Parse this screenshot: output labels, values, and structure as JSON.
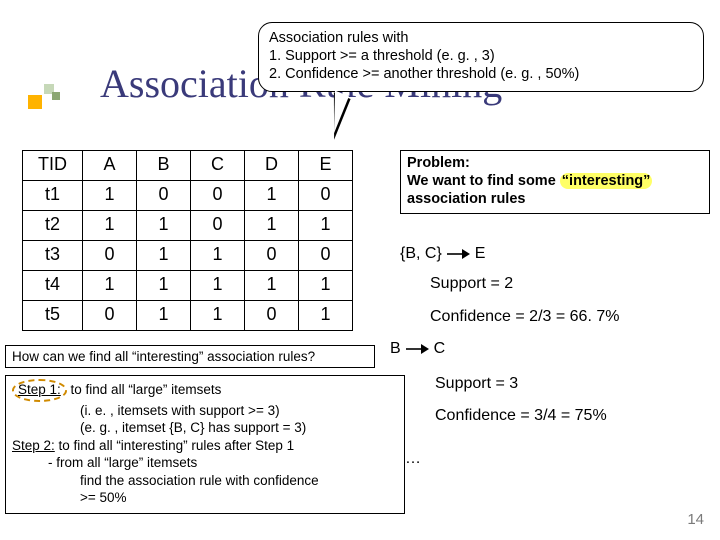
{
  "title": "Association Rule Mining",
  "callout": {
    "l1": "Association rules with",
    "l2": "1. Support >= a threshold (e. g. , 3)",
    "l3": "2. Confidence >= another threshold (e. g. , 50%)"
  },
  "table": {
    "headers": [
      "TID",
      "A",
      "B",
      "C",
      "D",
      "E"
    ],
    "rows": [
      [
        "t1",
        "1",
        "0",
        "0",
        "1",
        "0"
      ],
      [
        "t2",
        "1",
        "1",
        "0",
        "1",
        "1"
      ],
      [
        "t3",
        "0",
        "1",
        "1",
        "0",
        "0"
      ],
      [
        "t4",
        "1",
        "1",
        "1",
        "1",
        "1"
      ],
      [
        "t5",
        "0",
        "1",
        "1",
        "0",
        "1"
      ]
    ]
  },
  "problem": {
    "l1": "Problem:",
    "l2a": "We want to find some ",
    "l2b": "“interesting”",
    "l3": "association rules"
  },
  "ex1": {
    "lhs": "{B, C}",
    "rhs": "E",
    "support": "Support = 2",
    "conf": "Confidence = 2/3 = 66. 7%"
  },
  "ex2": {
    "lhs": "B",
    "rhs": "C",
    "support": "Support = 3",
    "conf": "Confidence = 3/4 = 75%"
  },
  "dots": "…",
  "how": "How can we find all “interesting” association rules?",
  "steps": {
    "s1a": "Step 1:",
    "s1b": " to find all “large” itemsets",
    "s1c": "(i. e. , itemsets with support >= 3)",
    "s1d": "(e. g. , itemset {B, C} has support = 3)",
    "s2a": "Step 2:",
    "s2b": " to find all “interesting” rules after Step 1",
    "s2c": "- from all “large” itemsets",
    "s2d": "find the association rule with confidence",
    "s2e": ">= 50%"
  },
  "pagenum": "14"
}
